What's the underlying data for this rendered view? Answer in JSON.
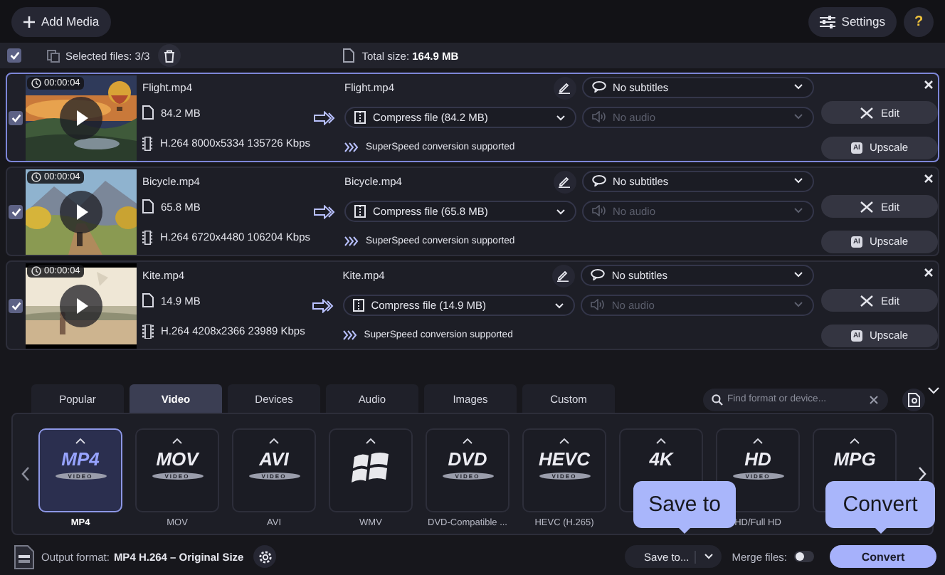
{
  "top_bar": {
    "add_media": "Add Media",
    "settings": "Settings",
    "help": "?"
  },
  "selection_bar": {
    "checked": true,
    "selected_text": "Selected files: 3/3",
    "total_text": "Total size: **164.9 MB**"
  },
  "files": [
    {
      "checked": true,
      "selected": true,
      "duration": "00:00:04",
      "name": "Flight.mp4",
      "size": "84.2 MB",
      "codec": "H.264 8000x5334 135726 Kbps",
      "output_name": "Flight.mp4",
      "compress": "Compress file (84.2 MB)",
      "speed_note": "SuperSpeed conversion supported",
      "subtitles": "No subtitles",
      "audio": "No audio",
      "audio_disabled": true,
      "edit": "Edit",
      "upscale": "Upscale",
      "upscale_badge": "AI"
    },
    {
      "checked": true,
      "selected": false,
      "duration": "00:00:04",
      "name": "Bicycle.mp4",
      "size": "65.8 MB",
      "codec": "H.264 6720x4480 106204 Kbps",
      "output_name": "Bicycle.mp4",
      "compress": "Compress file (65.8 MB)",
      "speed_note": "SuperSpeed conversion supported",
      "subtitles": "No subtitles",
      "audio": "No audio",
      "audio_disabled": true,
      "edit": "Edit",
      "upscale": "Upscale",
      "upscale_badge": "AI"
    },
    {
      "checked": true,
      "selected": false,
      "duration": "00:00:04",
      "name": "Kite.mp4",
      "size": "14.9 MB",
      "codec": "H.264 4208x2366 23989 Kbps",
      "output_name": "Kite.mp4",
      "compress": "Compress file (14.9 MB)",
      "speed_note": "SuperSpeed conversion supported",
      "subtitles": "No subtitles",
      "audio": "No audio",
      "audio_disabled": true,
      "edit": "Edit",
      "upscale": "Upscale",
      "upscale_badge": "AI"
    }
  ],
  "format_tabs": [
    {
      "label": "Popular",
      "selected": false
    },
    {
      "label": "Video",
      "selected": true
    },
    {
      "label": "Devices",
      "selected": false
    },
    {
      "label": "Audio",
      "selected": false
    },
    {
      "label": "Images",
      "selected": false
    },
    {
      "label": "Custom",
      "selected": false
    }
  ],
  "format_search": {
    "placeholder": "Find format or device..."
  },
  "formats": [
    {
      "kind": "logo",
      "logo": "MP4",
      "disc": "VIDEO",
      "label": "MP4",
      "selected": true
    },
    {
      "kind": "logo",
      "logo": "MOV",
      "disc": "VIDEO",
      "label": "MOV",
      "selected": false
    },
    {
      "kind": "logo",
      "logo": "AVI",
      "disc": "VIDEO",
      "label": "AVI",
      "selected": false
    },
    {
      "kind": "windows",
      "label": "WMV",
      "selected": false
    },
    {
      "kind": "logo",
      "logo": "DVD",
      "disc": "VIDEO",
      "label": "DVD-Compatible ...",
      "selected": false
    },
    {
      "kind": "logo",
      "logo": "HEVC",
      "disc": "VIDEO",
      "label": "HEVC (H.265)",
      "selected": false
    },
    {
      "kind": "logo",
      "logo": "4K",
      "selected": false
    },
    {
      "kind": "logo",
      "logo": "HD",
      "disc": "VIDEO",
      "label": "HD/Full HD",
      "selected": false
    },
    {
      "kind": "logo",
      "logo": "MPG",
      "selected": false
    }
  ],
  "bottom_bar": {
    "output_label": "Output format:",
    "output_value": "MP4 H.264 – Original Size",
    "save_to": "Save to...",
    "merge_label": "Merge files:",
    "merge_on": false,
    "convert": "Convert"
  },
  "callouts": [
    {
      "kind": "save",
      "text": "Save to"
    },
    {
      "kind": "convert",
      "text": "Convert"
    }
  ]
}
